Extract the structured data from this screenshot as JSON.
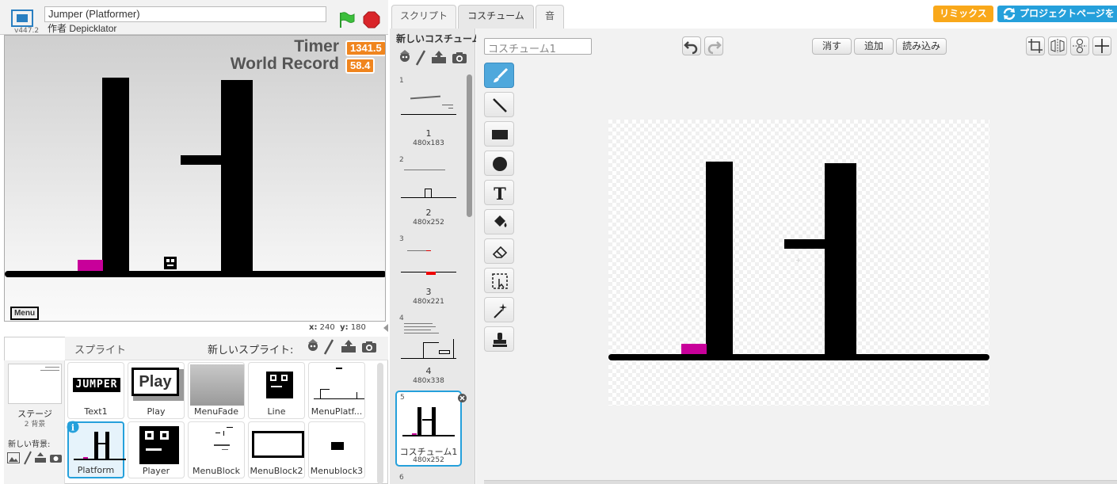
{
  "project": {
    "version": "v447.2",
    "title": "Jumper (Platformer)",
    "author": "作者 Depicklator"
  },
  "stage": {
    "timer_label": "Timer",
    "timer_value": "1341.5",
    "record_label": "World Record",
    "record_value": "58.4",
    "menu_label": "Menu",
    "coords": {
      "x_label": "x:",
      "x": "240",
      "y_label": "y:",
      "y": "180"
    }
  },
  "sprites_pane": {
    "title": "スプライト",
    "new_sprite": "新しいスプライト:",
    "stage_label": "ステージ",
    "stage_sub": "2 背景",
    "new_backdrop": "新しい背景:",
    "sprites": [
      {
        "name": "Text1",
        "selected": false
      },
      {
        "name": "Play",
        "selected": false
      },
      {
        "name": "MenuFade",
        "selected": false
      },
      {
        "name": "Line",
        "selected": false
      },
      {
        "name": "MenuPlatf...",
        "selected": false
      },
      {
        "name": "Platform",
        "selected": true
      },
      {
        "name": "Player",
        "selected": false
      },
      {
        "name": "MenuBlock",
        "selected": false
      },
      {
        "name": "MenuBlock2",
        "selected": false
      },
      {
        "name": "Menublock3",
        "selected": false
      }
    ],
    "thumb_texts": {
      "jumper": "JUMPER",
      "play": "Play"
    }
  },
  "tabs": [
    {
      "label": "スクリプト",
      "active": false
    },
    {
      "label": "コスチューム",
      "active": true
    },
    {
      "label": "音",
      "active": false
    }
  ],
  "header_buttons": {
    "remix": "リミックス",
    "project_page": "プロジェクトページを"
  },
  "costumes_pane": {
    "new_costume": "新しいコスチューム:",
    "costumes": [
      {
        "num": "1",
        "name": "1",
        "size": "480x183"
      },
      {
        "num": "2",
        "name": "2",
        "size": "480x252"
      },
      {
        "num": "3",
        "name": "3",
        "size": "480x221"
      },
      {
        "num": "4",
        "name": "4",
        "size": "480x338"
      },
      {
        "num": "5",
        "name": "コスチューム1",
        "size": "480x252",
        "selected": true
      },
      {
        "num": "6",
        "name": "",
        "size": ""
      }
    ]
  },
  "editor": {
    "costume_name_placeholder": "コスチューム1",
    "clear": "消す",
    "add": "追加",
    "import": "読み込み",
    "tools": [
      "brush-tool",
      "line-tool",
      "rectangle-tool",
      "ellipse-tool",
      "text-tool",
      "fill-tool",
      "eraser-tool",
      "select-tool",
      "magic-select-tool",
      "stamp-tool"
    ],
    "text_tool_glyph": "T"
  },
  "colors": {
    "accent_blue": "#25a0db",
    "remix_orange": "#f9a81a",
    "timer_orange": "#f0851e",
    "platform_magenta": "#c8009a"
  }
}
